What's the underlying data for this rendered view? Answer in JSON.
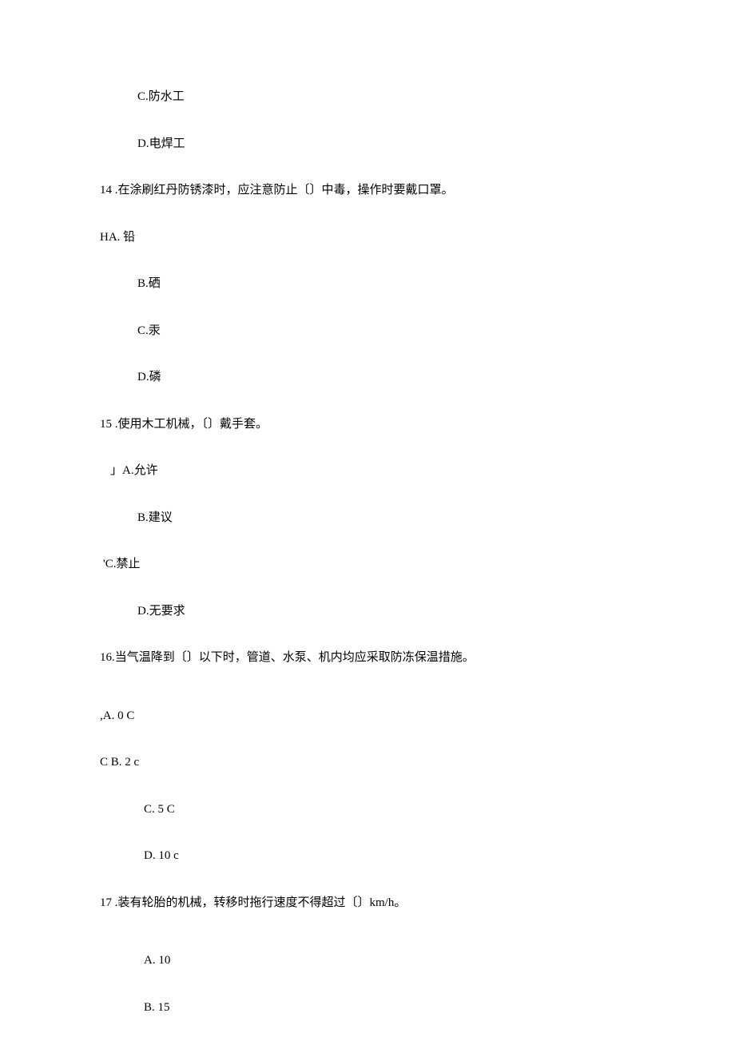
{
  "lines": {
    "q13_c": "C.防水工",
    "q13_d": "D.电焊工",
    "q14": "14 .在涂刷红丹防锈漆时，应注意防止〔〕中毒，操作时要戴口罩。",
    "q14_a": "HA. 铅",
    "q14_b": "B.硒",
    "q14_c": "C.汞",
    "q14_d": "D.磷",
    "q15": "15 .使用木工机械，〔〕戴手套。",
    "q15_a": "」A.允许",
    "q15_b": "B.建议",
    "q15_c": "'C.禁止",
    "q15_d": "D.无要求",
    "q16": "16.当气温降到〔〕以下时，管道、水泵、机内均应采取防冻保温措施。",
    "q16_a": ",A. 0 C",
    "q16_b": "C B. 2 c",
    "q16_c": "C. 5 C",
    "q16_d": "D. 10 c",
    "q17": "17 .装有轮胎的机械，转移时拖行速度不得超过〔〕km/h。",
    "q17_a": "A. 10",
    "q17_b": "B. 15"
  }
}
